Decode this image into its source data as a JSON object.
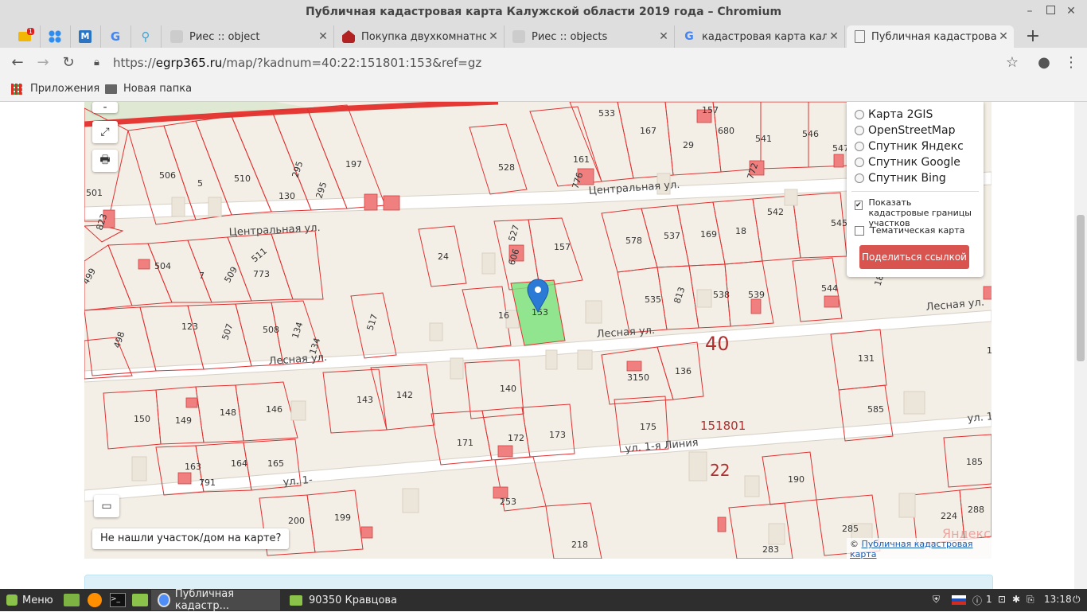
{
  "window": {
    "title": "Публичная кадастровая карта Калужской области 2019 года – Chromium",
    "minimize": "–",
    "close": "✕"
  },
  "tabs": [
    {
      "label": "Риес :: object",
      "icon": "doc-icon",
      "close": "✕"
    },
    {
      "label": "Покупка двухкомнатной",
      "icon": "house-icon",
      "close": "✕"
    },
    {
      "label": "Риес :: objects",
      "icon": "doc-icon",
      "close": "✕"
    },
    {
      "label": "кадастровая карта калуга",
      "icon": "google-icon",
      "close": "✕"
    },
    {
      "label": "Публичная кадастровая",
      "icon": "page-icon",
      "close": "✕",
      "active": true
    }
  ],
  "new_tab": "+",
  "address_bar": {
    "scheme": "https://",
    "host": "egrp365.ru",
    "path": "/map/?kadnum=40:22:151801:153&ref=gz"
  },
  "bookmarks": [
    {
      "label": "Приложения",
      "icon": "apps-grid-icon"
    },
    {
      "label": "Новая папка",
      "icon": "folder-icon"
    }
  ],
  "map": {
    "controls": {
      "minus": "-",
      "fullscreen": "⤢",
      "print": "🖶",
      "ruler": "▭"
    },
    "not_found_button": "Не нашли участок/дом на карте?",
    "attribution": {
      "prefix": "©",
      "link": "Публичная кадастровая карта"
    },
    "layers_panel": {
      "options": [
        "Карта 2GIS",
        "OpenStreetMap",
        "Спутник Яндекс",
        "Спутник Google",
        "Спутник Bing"
      ],
      "show_borders_label": "Показать кадастровые границы участков",
      "show_borders_checked": true,
      "thematic_label": "Тематическая карта",
      "thematic_checked": false,
      "share_button": "Поделиться ссылкой"
    },
    "streets": [
      "Центральная ул.",
      "Центральная ул.",
      "Лесная ул.",
      "Лесная ул.",
      "Лесная ул.",
      "ул. 1-я Линия",
      "ул. 1-я Линия",
      "ул. 1-"
    ],
    "quarter_labels": [
      "40",
      "151801",
      "22"
    ],
    "parcel_labels": [
      "533",
      "167",
      "157",
      "680",
      "29",
      "541",
      "546",
      "547",
      "501",
      "506",
      "5",
      "510",
      "295",
      "295",
      "130",
      "197",
      "528",
      "161",
      "776",
      "772",
      "823",
      "542",
      "545",
      "578",
      "537",
      "169",
      "18",
      "24",
      "527",
      "606",
      "157",
      "504",
      "7",
      "509",
      "511",
      "773",
      "499",
      "535",
      "813",
      "538",
      "539",
      "544",
      "182",
      "517",
      "16",
      "153",
      "123",
      "507",
      "508",
      "134",
      "134",
      "498",
      "131",
      "136",
      "3150",
      "140",
      "143",
      "142",
      "150",
      "149",
      "148",
      "146",
      "171",
      "172",
      "173",
      "175",
      "585",
      "163",
      "791",
      "164",
      "165",
      "253",
      "190",
      "185",
      "200",
      "199",
      "218",
      "283",
      "285",
      "224",
      "288",
      "12"
    ],
    "target_parcel": "153",
    "colors": {
      "background": "#f4efe6",
      "boundary": "#e03030",
      "selected_fill": "#7fe37f",
      "building": "#f08080",
      "pin": "#2b7bd6",
      "quarter": "#b03030"
    }
  },
  "taskbar": {
    "menu": "Меню",
    "tasks": [
      {
        "label": "Публичная кадастр...",
        "icon": "chromium-icon",
        "active": true
      },
      {
        "label": "90350 Кравцова",
        "icon": "folder-icon",
        "active": false
      }
    ],
    "tray_count": "1",
    "clock": "13:18"
  }
}
